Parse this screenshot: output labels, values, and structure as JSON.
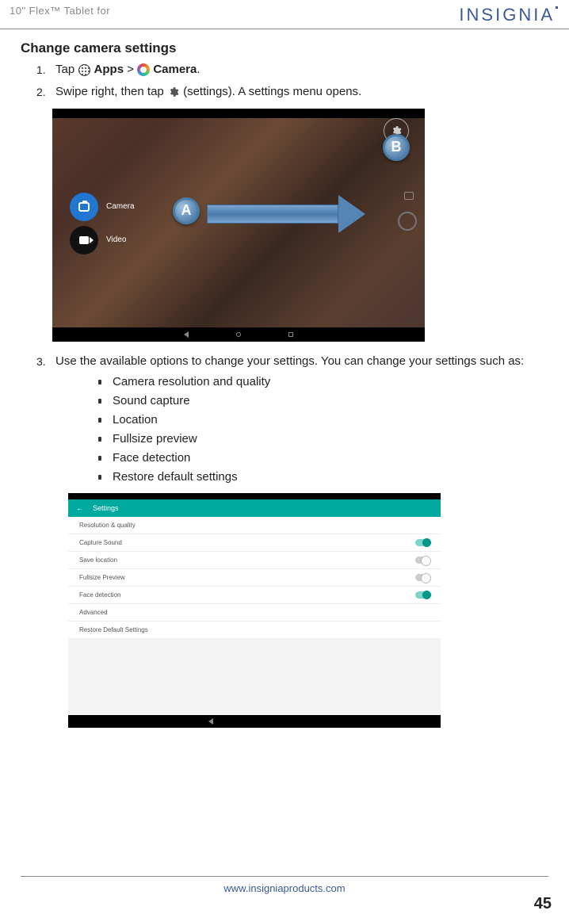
{
  "header": {
    "left": "10\" Flex™ Tablet for",
    "brand": "INSIGNIA"
  },
  "heading": "Change camera settings",
  "step1": {
    "num": "1.",
    "pre": "Tap ",
    "apps": "Apps",
    "gt": " > ",
    "camera": "Camera",
    "post": "."
  },
  "step2": {
    "num": "2.",
    "pre": "Swipe right, then tap  ",
    "mid": " (settings). A settings menu opens."
  },
  "camera_menu": {
    "camera": "Camera",
    "video": "Video",
    "labelA": "A",
    "labelB": "B"
  },
  "step3": {
    "num": "3.",
    "text": "Use the available options to change your settings. You can change your settings such as:"
  },
  "options": {
    "o1": "Camera resolution and quality",
    "o2": "Sound capture",
    "o3": "Location",
    "o4": "Fullsize preview",
    "o5": "Face detection",
    "o6": "Restore default settings"
  },
  "settings_screen": {
    "back": "←",
    "title": "Settings",
    "r1": "Resolution & quality",
    "r2": "Capture Sound",
    "r3": "Save location",
    "r4": "Fullsize Preview",
    "r5": "Face detection",
    "r6": "Advanced",
    "r7": "Restore Default Settings"
  },
  "footer": {
    "url": "www.insigniaproducts.com",
    "page": "45"
  }
}
